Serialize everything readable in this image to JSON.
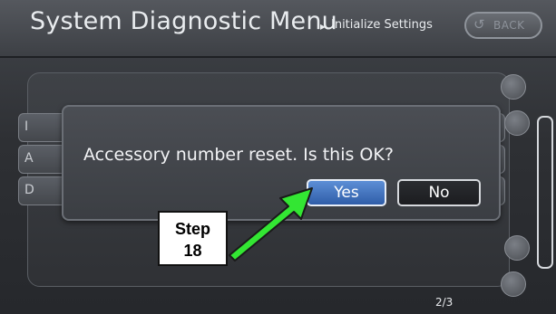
{
  "header": {
    "title": "System Diagnostic Menu",
    "breadcrumb_arrow": "▸",
    "breadcrumb": "Initialize Settings",
    "back_icon": "↺",
    "back_label": "BACK"
  },
  "list": {
    "row_letters": [
      "I",
      "A",
      "D"
    ]
  },
  "dialog": {
    "message": "Accessory number reset.  Is this OK?",
    "yes_label": "Yes",
    "no_label": "No"
  },
  "pager": {
    "page": "2/3"
  },
  "callout": {
    "line1": "Step",
    "line2": "18",
    "arrow_color": "#33e633"
  }
}
